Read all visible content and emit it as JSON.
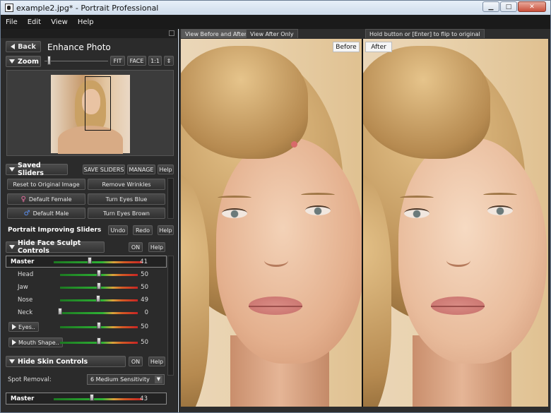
{
  "window": {
    "title": "example2.jpg* - Portrait Professional"
  },
  "menu": [
    "File",
    "Edit",
    "View",
    "Help"
  ],
  "panel": {
    "back_label": "Back",
    "title": "Enhance Photo",
    "zoom": {
      "label": "Zoom",
      "fit": "FIT",
      "face": "FACE",
      "one": "1:1",
      "updown": "⇕"
    },
    "saved_sliders": {
      "label": "Saved Sliders",
      "save": "SAVE SLIDERS",
      "manage": "MANAGE",
      "help": "Help",
      "presets": [
        "Reset to Original Image",
        "Remove Wrinkles",
        "Default Female",
        "Turn Eyes Blue",
        "Default Male",
        "Turn Eyes Brown"
      ]
    },
    "improving": {
      "label": "Portrait Improving Sliders",
      "undo": "Undo",
      "redo": "Redo",
      "help": "Help"
    },
    "face_sculpt": {
      "label": "Hide Face Sculpt Controls",
      "on": "ON",
      "help": "Help",
      "sliders": [
        {
          "name": "Master",
          "value": 41
        },
        {
          "name": "Head",
          "value": 50
        },
        {
          "name": "Jaw",
          "value": 50
        },
        {
          "name": "Nose",
          "value": 49
        },
        {
          "name": "Neck",
          "value": 0
        },
        {
          "name": "Eyes..",
          "value": 50
        },
        {
          "name": "Mouth Shape..",
          "value": 50
        }
      ]
    },
    "skin": {
      "label": "Hide Skin Controls",
      "on": "ON",
      "help": "Help",
      "spot_label": "Spot Removal:",
      "spot_value": "6 Medium Sensitivity",
      "master": {
        "name": "Master",
        "value": 43
      }
    }
  },
  "view": {
    "tabs": [
      "View Before and After",
      "View After Only"
    ],
    "flip_hint": "Hold button or [Enter] to flip to original",
    "before": "Before",
    "after": "After"
  },
  "icons": {
    "female": "female-icon",
    "male": "male-icon"
  }
}
